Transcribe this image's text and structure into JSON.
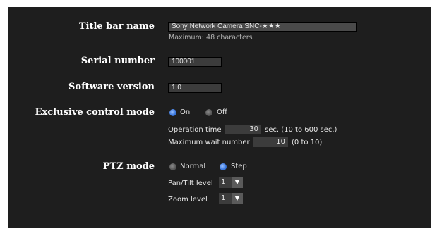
{
  "title_bar": {
    "label": "Title bar name",
    "value": "Sony Network Camera SNC-★★★",
    "hint": "Maximum: 48 characters"
  },
  "serial": {
    "label": "Serial number",
    "value": "100001"
  },
  "software": {
    "label": "Software version",
    "value": "1.0"
  },
  "exclusive": {
    "label": "Exclusive control mode",
    "on_label": "On",
    "off_label": "Off",
    "op_time_label": "Operation time",
    "op_time_value": "30",
    "op_time_range": "sec. (10 to 600 sec.)",
    "max_wait_label": "Maximum wait number",
    "max_wait_value": "10",
    "max_wait_range": "(0 to 10)"
  },
  "ptz": {
    "label": "PTZ mode",
    "normal_label": "Normal",
    "step_label": "Step",
    "pan_tilt_label": "Pan/Tilt level",
    "pan_tilt_value": "1",
    "zoom_label": "Zoom level",
    "zoom_value": "1"
  },
  "icons": {
    "dropdown": "▼"
  }
}
